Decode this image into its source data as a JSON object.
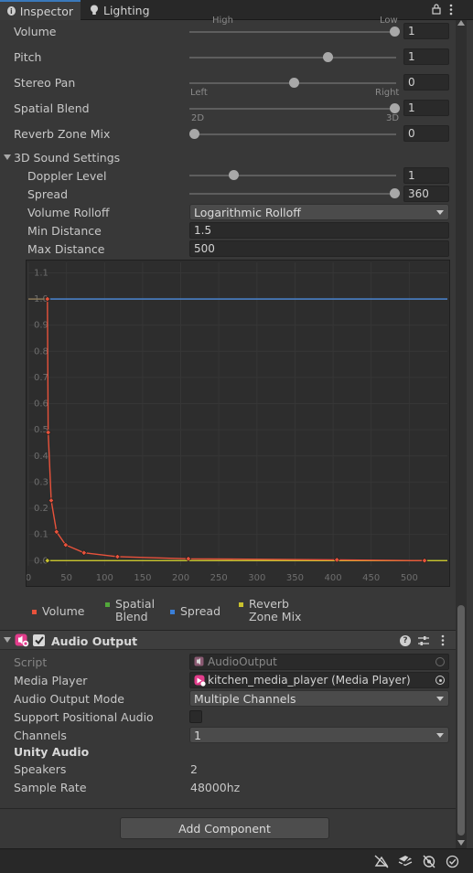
{
  "tabs": [
    {
      "label": "Inspector"
    },
    {
      "label": "Lighting"
    }
  ],
  "top_cutoff": {
    "left": "High",
    "right": "Low"
  },
  "properties": {
    "volume": {
      "label": "Volume",
      "value": "1"
    },
    "pitch": {
      "label": "Pitch",
      "value": "1"
    },
    "stereo_pan": {
      "label": "Stereo Pan",
      "value": "0",
      "min_label": "Left",
      "max_label": "Right"
    },
    "spatial_blend": {
      "label": "Spatial Blend",
      "value": "1",
      "min_label": "2D",
      "max_label": "3D"
    },
    "reverb_zone_mix": {
      "label": "Reverb Zone Mix",
      "value": "0"
    }
  },
  "sound3d": {
    "title": "3D Sound Settings",
    "doppler": {
      "label": "Doppler Level",
      "value": "1"
    },
    "spread": {
      "label": "Spread",
      "value": "360"
    },
    "rolloff": {
      "label": "Volume Rolloff",
      "value": "Logarithmic Rolloff"
    },
    "min_distance": {
      "label": "Min Distance",
      "value": "1.5"
    },
    "max_distance": {
      "label": "Max Distance",
      "value": "500"
    }
  },
  "chart_data": {
    "type": "line",
    "title": "",
    "xlabel": "",
    "ylabel": "",
    "xlim": [
      0,
      550
    ],
    "ylim": [
      -0.02,
      1.14
    ],
    "x_ticks": [
      "0",
      "50",
      "100",
      "150",
      "200",
      "250",
      "300",
      "350",
      "400",
      "450",
      "500"
    ],
    "y_ticks": [
      "0.0",
      "0.1",
      "0.2",
      "0.3",
      "0.4",
      "0.5",
      "0.6",
      "0.7",
      "0.8",
      "0.9",
      "1.0",
      "1.1"
    ],
    "grid": true,
    "series": [
      {
        "name": "Volume",
        "color": "#e8523b",
        "x": [
          25,
          26,
          30,
          37,
          49,
          73,
          117,
          210,
          405,
          520
        ],
        "y": [
          1.0,
          0.49,
          0.23,
          0.11,
          0.06,
          0.03,
          0.015,
          0.007,
          0.003,
          0.0
        ]
      },
      {
        "name": "Spatial Blend",
        "color": "#52a83a",
        "x": [
          25,
          550
        ],
        "y": [
          0.0,
          0.0
        ]
      },
      {
        "name": "Spread",
        "color": "#3a7fd8",
        "x": [
          25,
          550
        ],
        "y": [
          1.0,
          1.0
        ]
      },
      {
        "name": "Reverb Zone Mix",
        "color": "#c9c22e",
        "x": [
          25,
          550
        ],
        "y": [
          0.0,
          0.0
        ]
      }
    ],
    "listener_line": {
      "y": 1.0,
      "color": "#8a7a5a"
    }
  },
  "legend": [
    {
      "line1": "Volume",
      "line2": "",
      "color": "#e8523b"
    },
    {
      "line1": "Spatial",
      "line2": "Blend",
      "color": "#52a83a"
    },
    {
      "line1": "Spread",
      "line2": "",
      "color": "#3a7fd8"
    },
    {
      "line1": "Reverb",
      "line2": "Zone Mix",
      "color": "#c9c22e"
    }
  ],
  "audio_output": {
    "title": "Audio Output",
    "enabled": true,
    "script": {
      "label": "Script",
      "value": "AudioOutput"
    },
    "media_player": {
      "label": "Media Player",
      "value": "kitchen_media_player (Media Player)"
    },
    "output_mode": {
      "label": "Audio Output Mode",
      "value": "Multiple Channels"
    },
    "positional": {
      "label": "Support Positional Audio",
      "checked": false
    },
    "channels": {
      "label": "Channels",
      "value": "1"
    },
    "unity_audio": {
      "label": "Unity Audio"
    },
    "speakers": {
      "label": "Speakers",
      "value": "2"
    },
    "sample_rate": {
      "label": "Sample Rate",
      "value": "48000hz"
    }
  },
  "add_component": {
    "label": "Add Component"
  },
  "colors": {
    "panel": "#383838",
    "field": "#2a2a2a",
    "accent": "#3a79bb"
  }
}
